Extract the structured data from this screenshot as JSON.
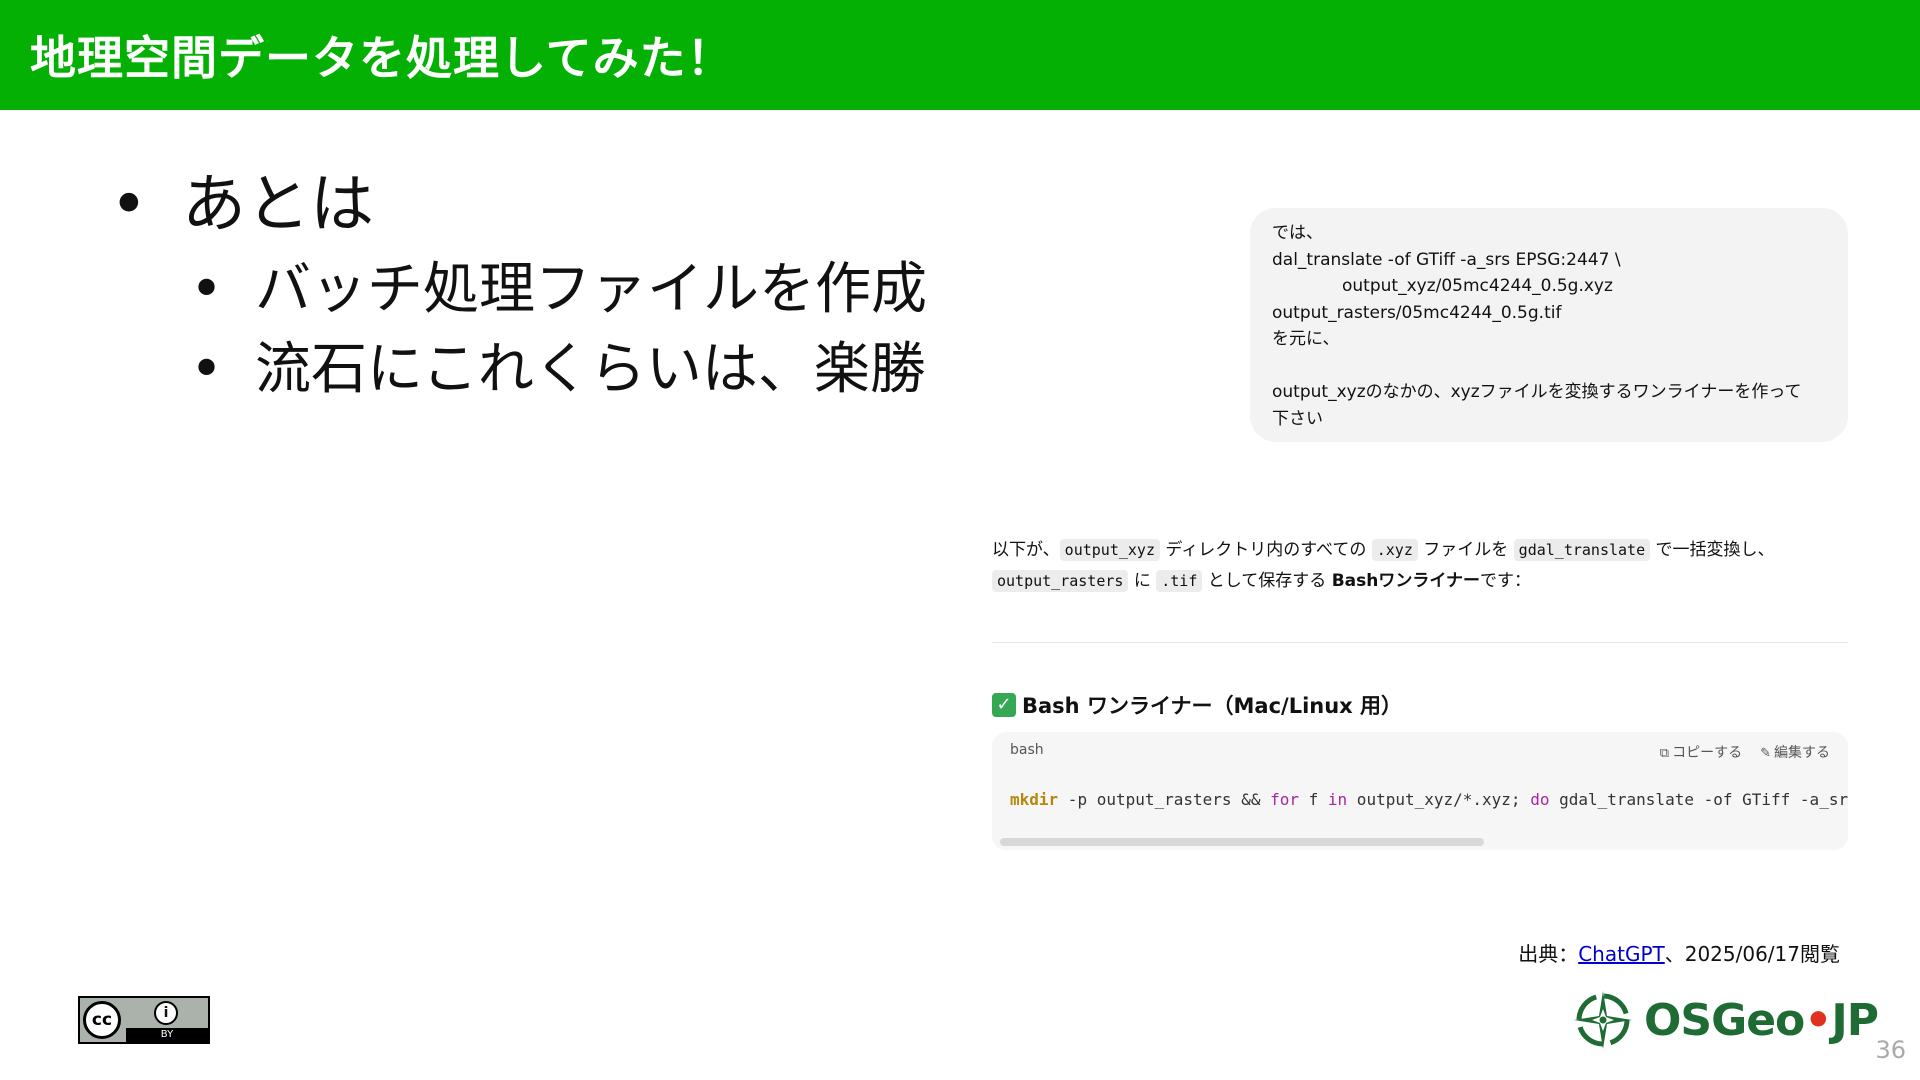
{
  "header": {
    "title": "地理空間データを処理してみた！"
  },
  "bullets": {
    "main": "あとは",
    "sub": [
      "バッチ処理ファイルを作成",
      "流石にこれくらいは、楽勝"
    ]
  },
  "prompt": {
    "line1": "では、",
    "line2": "dal_translate -of GTiff -a_srs EPSG:2447 \\",
    "line3": "output_xyz/05mc4244_0.5g.xyz",
    "line4": "output_rasters/05mc4244_0.5g.tif",
    "line5": "を元に、",
    "line6": "output_xyzのなかの、xyzファイルを変換するワンライナーを作って",
    "line7": "下さい"
  },
  "answer": {
    "t1": "以下が、",
    "c1": "output_xyz",
    "t2": " ディレクトリ内のすべての ",
    "c2": ".xyz",
    "t3": " ファイルを ",
    "c3": "gdal_translate",
    "t4": " で一括変換し、",
    "c4": "output_rasters",
    "t5": " に ",
    "c5": ".tif",
    "t6": " として保存する ",
    "bold": "Bashワンライナー",
    "t7": "です："
  },
  "code_section": {
    "heading": "Bash ワンライナー（Mac/Linux 用）",
    "lang": "bash",
    "copy_label": "コピーする",
    "edit_label": "編集する",
    "tok_mkdir": "mkdir",
    "tok_1": " -p output_rasters && ",
    "tok_for": "for",
    "tok_2": " f ",
    "tok_in": "in",
    "tok_3": " output_xyz/*.xyz; ",
    "tok_do": "do",
    "tok_4": " gdal_translate -of GTiff -a_srs"
  },
  "source": {
    "prefix": "出典：",
    "link": "ChatGPT",
    "suffix": "、2025/06/17閲覧"
  },
  "license": {
    "cc": "cc",
    "by": "BY",
    "by_symbol": "i"
  },
  "logo": {
    "text_a": "OSGeo",
    "text_dot": "•",
    "text_b": "JP"
  },
  "page_number": "36",
  "colors": {
    "header_bg": "#04b004",
    "link": "#0000cc",
    "osgeo_green": "#1e6b33"
  }
}
